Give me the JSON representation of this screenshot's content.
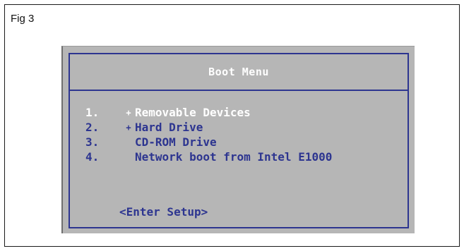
{
  "figure": {
    "caption": "Fig 3"
  },
  "boot_menu": {
    "title": "Boot Menu",
    "items": [
      {
        "number": "1.",
        "marker": "+",
        "label": "Removable Devices",
        "selected": true
      },
      {
        "number": "2.",
        "marker": "+",
        "label": "Hard Drive",
        "selected": false
      },
      {
        "number": "3.",
        "marker": "",
        "label": "CD-ROM Drive",
        "selected": false
      },
      {
        "number": "4.",
        "marker": "",
        "label": "Network boot from Intel E1000",
        "selected": false
      }
    ],
    "setup_option": "<Enter Setup>"
  },
  "colors": {
    "panel_background": "#b6b6b6",
    "border_blue": "#2d3590",
    "text_blue": "#2d3590",
    "highlight_text": "#ffffff"
  }
}
